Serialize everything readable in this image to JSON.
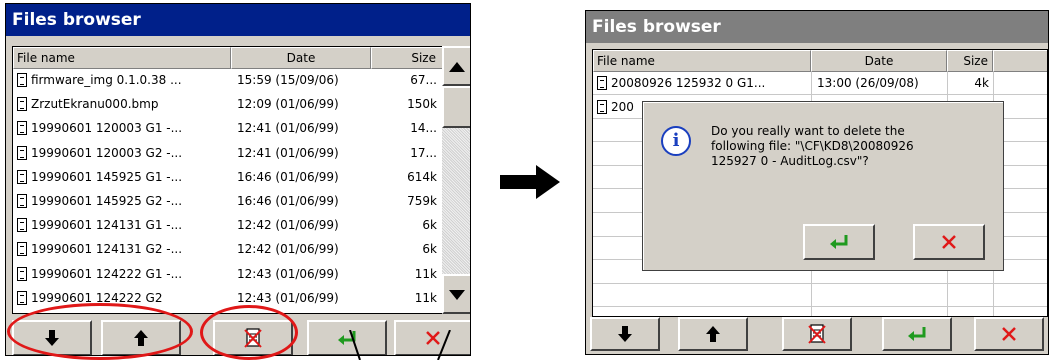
{
  "left": {
    "title": "Files browser",
    "columns": [
      "File name",
      "Date",
      "Size"
    ],
    "rows": [
      {
        "name": "firmware_img 0.1.0.38 ...",
        "date": "15:59 (15/09/06)",
        "size": "67..."
      },
      {
        "name": "ZrzutEkranu000.bmp",
        "date": "12:09 (01/06/99)",
        "size": "150k"
      },
      {
        "name": "19990601 120003 G1 -...",
        "date": "12:41 (01/06/99)",
        "size": "14..."
      },
      {
        "name": "19990601 120003 G2 -...",
        "date": "12:41 (01/06/99)",
        "size": "17..."
      },
      {
        "name": "19990601 145925 G1 -...",
        "date": "16:46 (01/06/99)",
        "size": "614k"
      },
      {
        "name": "19990601 145925 G2 -...",
        "date": "16:46 (01/06/99)",
        "size": "759k"
      },
      {
        "name": "19990601 124131 G1 -...",
        "date": "12:42 (01/06/99)",
        "size": "6k"
      },
      {
        "name": "19990601 124131 G2 -...",
        "date": "12:42 (01/06/99)",
        "size": "6k"
      },
      {
        "name": "19990601 124222 G1 -...",
        "date": "12:43 (01/06/99)",
        "size": "11k"
      },
      {
        "name": "19990601 124222 G2",
        "date": "12:43 (01/06/99)",
        "size": "11k"
      }
    ]
  },
  "right": {
    "title": "Files browser",
    "columns": [
      "File name",
      "Date",
      "Size"
    ],
    "rows": [
      {
        "name": "20080926 125932 0 G1...",
        "date": "13:00 (26/09/08)",
        "size": "4k"
      },
      {
        "name": "200",
        "date": "",
        "size": ""
      }
    ],
    "dialog": {
      "message_line1": "Do you really want to delete the",
      "message_line2": "following file: \"\\CF\\KD8\\20080926",
      "message_line3": "125927 0 - AuditLog.csv\"?"
    }
  },
  "icons": {
    "down": "arrow-down-icon",
    "up": "arrow-up-icon",
    "delete": "delete-file-icon",
    "enter": "enter-icon",
    "close": "close-x-icon",
    "info": "info-icon",
    "next": "right-arrow-icon"
  },
  "colors": {
    "title_active": "#00208a",
    "title_inactive": "#7f7f7f",
    "highlight": "#e01818",
    "enter_green": "#1f9a1f",
    "cancel_red": "#e01818"
  }
}
